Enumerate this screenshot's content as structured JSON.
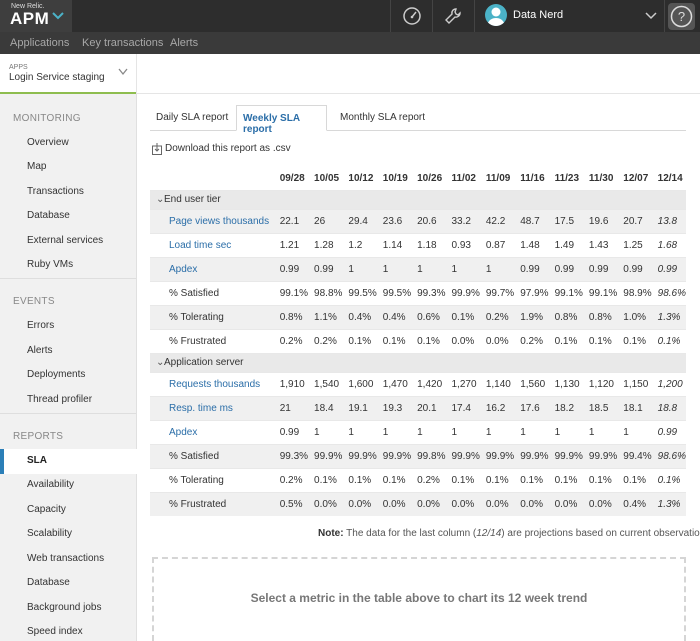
{
  "topbar": {
    "brand_small": "New Relic.",
    "brand_name": "APM",
    "user_name": "Data Nerd",
    "icons": [
      "speedometer-icon",
      "wrench-icon",
      "user-avatar",
      "chevron-down-icon",
      "help-icon"
    ]
  },
  "nav": {
    "items": [
      "Applications",
      "Key transactions",
      "Alerts"
    ]
  },
  "app": {
    "label": "APPS",
    "name": "Login Service staging"
  },
  "sidebar": {
    "monitoring_title": "MONITORING",
    "monitoring": [
      "Overview",
      "Map",
      "Transactions",
      "Database",
      "External services",
      "Ruby VMs"
    ],
    "events_title": "EVENTS",
    "events": [
      "Errors",
      "Alerts",
      "Deployments",
      "Thread profiler"
    ],
    "reports_title": "REPORTS",
    "reports_active": "SLA",
    "reports": [
      "Availability",
      "Capacity",
      "Scalability",
      "Web transactions",
      "Database",
      "Background jobs",
      "Speed index"
    ]
  },
  "tabs": [
    "Daily SLA report",
    "Weekly SLA report",
    "Monthly SLA report"
  ],
  "active_tab": "Weekly SLA report",
  "download_label": "Download this report as .csv",
  "table": {
    "columns": [
      "09/28",
      "10/05",
      "10/12",
      "10/19",
      "10/26",
      "11/02",
      "11/09",
      "11/16",
      "11/23",
      "11/30",
      "12/07",
      "12/14"
    ],
    "groups": [
      {
        "name": "End user tier",
        "rows": [
          {
            "label": "Page views thousands",
            "link": true,
            "shade": true,
            "values": [
              "22.1",
              "26",
              "29.4",
              "23.6",
              "20.6",
              "33.2",
              "42.2",
              "48.7",
              "17.5",
              "19.6",
              "20.7",
              "13.8"
            ]
          },
          {
            "label": "Load time sec",
            "link": true,
            "shade": false,
            "values": [
              "1.21",
              "1.28",
              "1.2",
              "1.14",
              "1.18",
              "0.93",
              "0.87",
              "1.48",
              "1.49",
              "1.43",
              "1.25",
              "1.68"
            ]
          },
          {
            "label": "Apdex",
            "link": true,
            "shade": true,
            "values": [
              "0.99",
              "0.99",
              "1",
              "1",
              "1",
              "1",
              "1",
              "0.99",
              "0.99",
              "0.99",
              "0.99",
              "0.99"
            ]
          },
          {
            "label": "% Satisfied",
            "link": false,
            "shade": false,
            "values": [
              "99.1%",
              "98.8%",
              "99.5%",
              "99.5%",
              "99.3%",
              "99.9%",
              "99.7%",
              "97.9%",
              "99.1%",
              "99.1%",
              "98.9%",
              "98.6%"
            ]
          },
          {
            "label": "% Tolerating",
            "link": false,
            "shade": true,
            "values": [
              "0.8%",
              "1.1%",
              "0.4%",
              "0.4%",
              "0.6%",
              "0.1%",
              "0.2%",
              "1.9%",
              "0.8%",
              "0.8%",
              "1.0%",
              "1.3%"
            ]
          },
          {
            "label": "% Frustrated",
            "link": false,
            "shade": false,
            "values": [
              "0.2%",
              "0.2%",
              "0.1%",
              "0.1%",
              "0.1%",
              "0.0%",
              "0.0%",
              "0.2%",
              "0.1%",
              "0.1%",
              "0.1%",
              "0.1%"
            ]
          }
        ]
      },
      {
        "name": "Application server",
        "rows": [
          {
            "label": "Requests thousands",
            "link": true,
            "shade": false,
            "values": [
              "1,910",
              "1,540",
              "1,600",
              "1,470",
              "1,420",
              "1,270",
              "1,140",
              "1,560",
              "1,130",
              "1,120",
              "1,150",
              "1,200"
            ]
          },
          {
            "label": "Resp. time ms",
            "link": true,
            "shade": true,
            "values": [
              "21",
              "18.4",
              "19.1",
              "19.3",
              "20.1",
              "17.4",
              "16.2",
              "17.6",
              "18.2",
              "18.5",
              "18.1",
              "18.8"
            ]
          },
          {
            "label": "Apdex",
            "link": true,
            "shade": false,
            "values": [
              "0.99",
              "1",
              "1",
              "1",
              "1",
              "1",
              "1",
              "1",
              "1",
              "1",
              "1",
              "0.99"
            ]
          },
          {
            "label": "% Satisfied",
            "link": false,
            "shade": true,
            "values": [
              "99.3%",
              "99.9%",
              "99.9%",
              "99.9%",
              "99.8%",
              "99.9%",
              "99.9%",
              "99.9%",
              "99.9%",
              "99.9%",
              "99.4%",
              "98.6%"
            ]
          },
          {
            "label": "% Tolerating",
            "link": false,
            "shade": false,
            "values": [
              "0.2%",
              "0.1%",
              "0.1%",
              "0.1%",
              "0.2%",
              "0.1%",
              "0.1%",
              "0.1%",
              "0.1%",
              "0.1%",
              "0.1%",
              "0.1%"
            ]
          },
          {
            "label": "% Frustrated",
            "link": false,
            "shade": true,
            "values": [
              "0.5%",
              "0.0%",
              "0.0%",
              "0.0%",
              "0.0%",
              "0.0%",
              "0.0%",
              "0.0%",
              "0.0%",
              "0.0%",
              "0.4%",
              "1.3%"
            ]
          }
        ]
      }
    ]
  },
  "note": {
    "prefix": "Note:",
    "before": "The data for the last column (",
    "col": "12/14",
    "after": ") are projections based on current observations."
  },
  "chart_prompt": "Select a metric in the table above to chart its 12 week trend",
  "colors": {
    "link": "#2b6ea8",
    "active_bar": "#2b7fb8",
    "header_bg": "#2d2d2d",
    "app_accent": "#8ebd4f"
  }
}
